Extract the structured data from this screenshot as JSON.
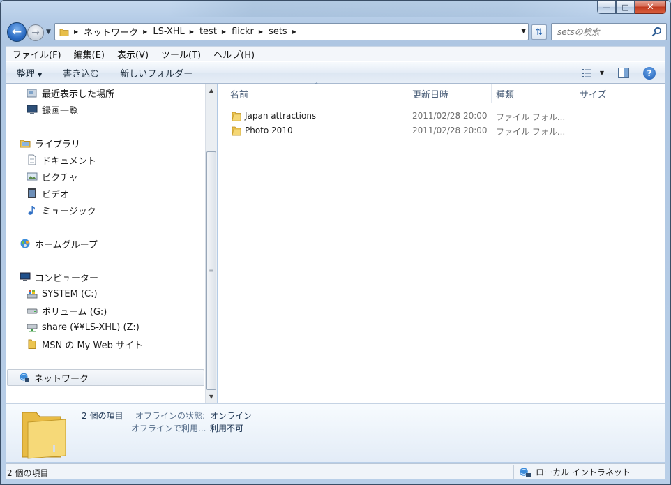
{
  "window": {
    "min_glyph": "—",
    "max_glyph": "□",
    "close_glyph": "✕"
  },
  "address_bar": {
    "crumbs": [
      "ネットワーク",
      "LS-XHL",
      "test",
      "flickr",
      "sets"
    ],
    "search_placeholder": "setsの検索"
  },
  "menu": {
    "items": [
      "ファイル(F)",
      "編集(E)",
      "表示(V)",
      "ツール(T)",
      "ヘルプ(H)"
    ]
  },
  "toolbar": {
    "organize_label": "整理",
    "burn_label": "書き込む",
    "new_folder_label": "新しいフォルダー"
  },
  "nav_pane": {
    "items": [
      {
        "label": "最近表示した場所",
        "icon": "recent-places-icon"
      },
      {
        "label": "録画一覧",
        "icon": "recorded-tv-icon"
      },
      {
        "label": "ライブラリ",
        "icon": "libraries-icon"
      },
      {
        "label": "ドキュメント",
        "icon": "documents-icon"
      },
      {
        "label": "ピクチャ",
        "icon": "pictures-icon"
      },
      {
        "label": "ビデオ",
        "icon": "videos-icon"
      },
      {
        "label": "ミュージック",
        "icon": "music-icon"
      },
      {
        "label": "ホームグループ",
        "icon": "homegroup-icon"
      },
      {
        "label": "コンピューター",
        "icon": "computer-icon"
      },
      {
        "label": "SYSTEM (C:)",
        "icon": "system-drive-icon"
      },
      {
        "label": "ボリューム (G:)",
        "icon": "drive-icon"
      },
      {
        "label": "share (¥¥LS-XHL) (Z:)",
        "icon": "network-drive-icon"
      },
      {
        "label": "MSN の My Web サイト",
        "icon": "folder-icon"
      },
      {
        "label": "ネットワーク",
        "icon": "network-icon"
      }
    ]
  },
  "file_list": {
    "columns": [
      "名前",
      "更新日時",
      "種類",
      "サイズ"
    ],
    "rows": [
      {
        "name": "Japan attractions",
        "modified": "2011/02/28 20:00",
        "type": "ファイル フォル..."
      },
      {
        "name": "Photo 2010",
        "modified": "2011/02/28 20:00",
        "type": "ファイル フォル..."
      }
    ]
  },
  "details_pane": {
    "count": "2 個の項目",
    "offline_status_label": "オフラインの状態:",
    "offline_status_value": "オンライン",
    "offline_avail_label": "オフラインで利用...",
    "offline_avail_value": "利用不可"
  },
  "status_bar": {
    "count": "2 個の項目",
    "zone": "ローカル イントラネット"
  },
  "colors": {
    "frame": "#b4cbe6",
    "selection": "#e6ecf3",
    "folder_yellow": "#f2c94c"
  }
}
